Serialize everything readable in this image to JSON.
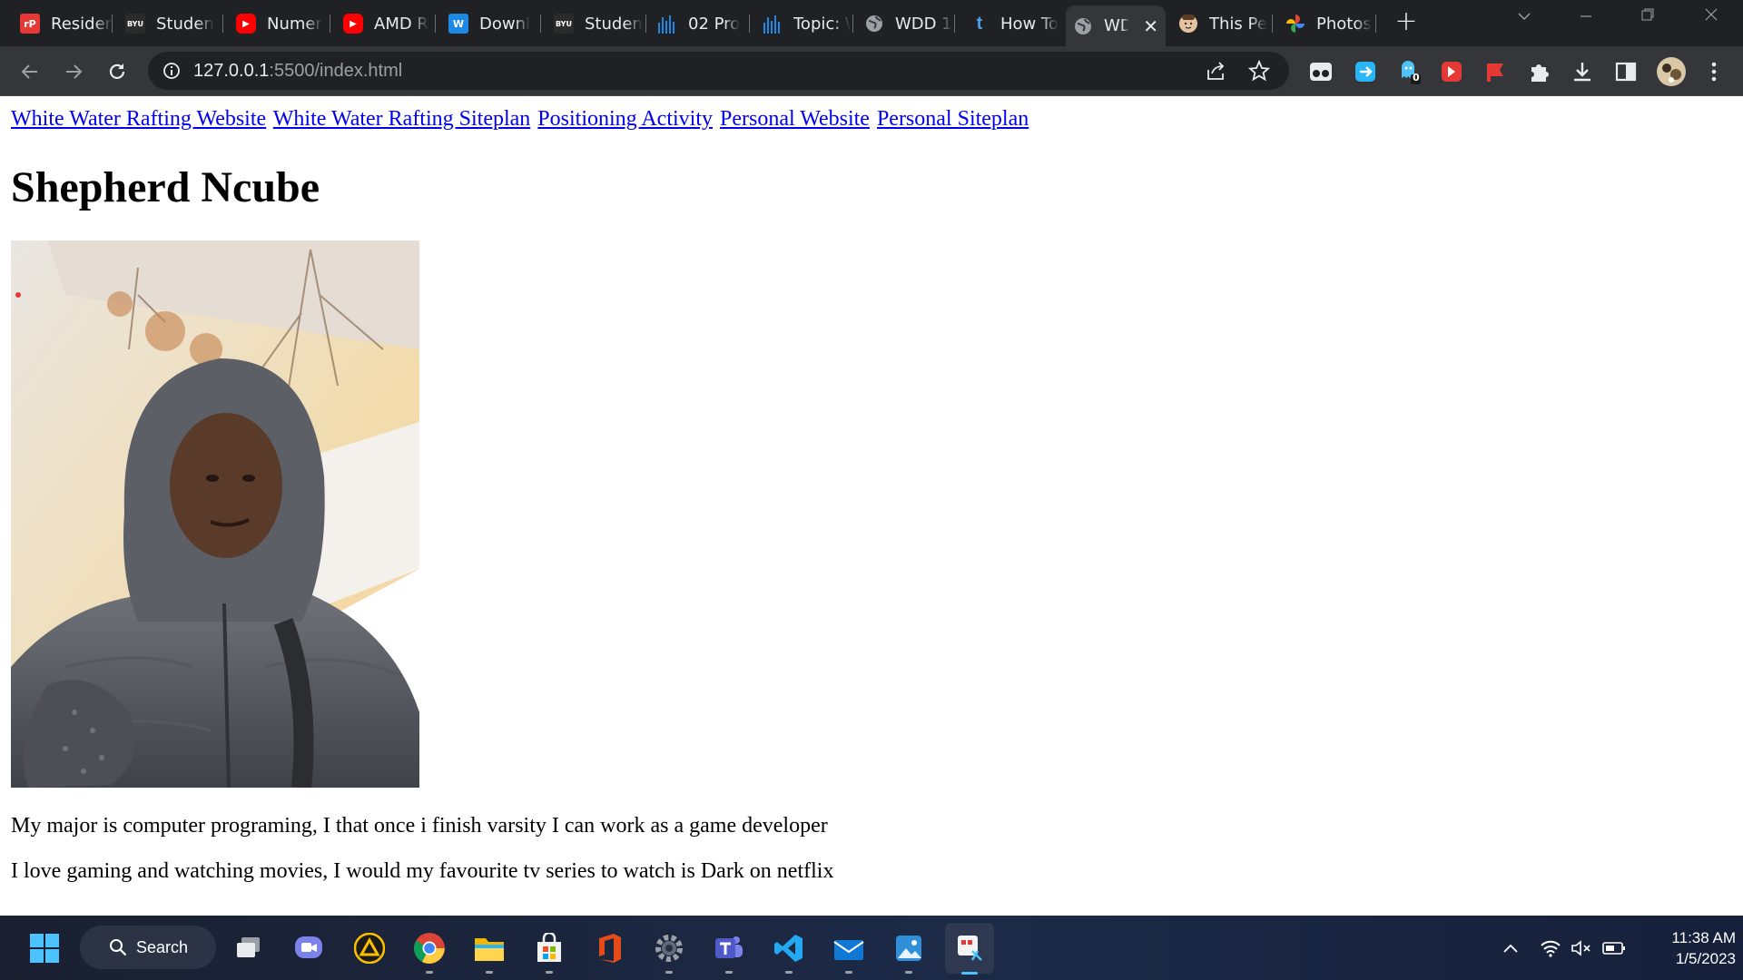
{
  "browser": {
    "tabs": [
      {
        "title": "Residen",
        "icon": "rp-icon",
        "color": "#e53935",
        "glyph": "rP"
      },
      {
        "title": "Studen",
        "icon": "byu-idaho-icon",
        "color": "#3c4043",
        "glyph": "BYU"
      },
      {
        "title": "Numer",
        "icon": "youtube-icon",
        "color": "#ff0000",
        "glyph": "▶"
      },
      {
        "title": "AMD R",
        "icon": "youtube-icon",
        "color": "#ff0000",
        "glyph": "▶"
      },
      {
        "title": "Downl",
        "icon": "doc-icon",
        "color": "#1e88e5",
        "glyph": "W"
      },
      {
        "title": "Studen",
        "icon": "byu-idaho-icon",
        "color": "#3c4043",
        "glyph": "BYU"
      },
      {
        "title": "02 Pro",
        "icon": "bars-icon",
        "color": "#1976d2",
        "glyph": "▌"
      },
      {
        "title": "Topic: \\",
        "icon": "bars-icon",
        "color": "#1976d2",
        "glyph": "▌"
      },
      {
        "title": "WDD 1",
        "icon": "globe-icon",
        "color": "#9aa0a6",
        "glyph": "◉"
      },
      {
        "title": "How To",
        "icon": "tumblr-icon",
        "color": "#35363a",
        "glyph": "t"
      },
      {
        "title": "WD",
        "icon": "globe-icon",
        "color": "#9aa0a6",
        "glyph": "◉",
        "active": true
      },
      {
        "title": "This Pe",
        "icon": "face-icon",
        "color": "#c49a6c",
        "glyph": "☺"
      },
      {
        "title": "Photos",
        "icon": "photos-icon",
        "color": "#fbbc04",
        "glyph": "✿"
      }
    ],
    "url_host": "127.0.0.1",
    "url_rest": ":5500/index.html",
    "extension_badge": "0"
  },
  "page": {
    "nav_links": [
      "White Water Rafting Website",
      "White Water Rafting Siteplan",
      "Positioning Activity",
      "Personal Website",
      "Personal Siteplan"
    ],
    "heading": "Shepherd Ncube",
    "bio": [
      "My major is computer programing, I that once i finish varsity I can work as a game developer",
      "I love gaming and watching movies, I would my favourite tv series to watch is Dark on netflix"
    ]
  },
  "taskbar": {
    "search_label": "Search",
    "time": "11:38 AM",
    "date": "1/5/2023"
  }
}
